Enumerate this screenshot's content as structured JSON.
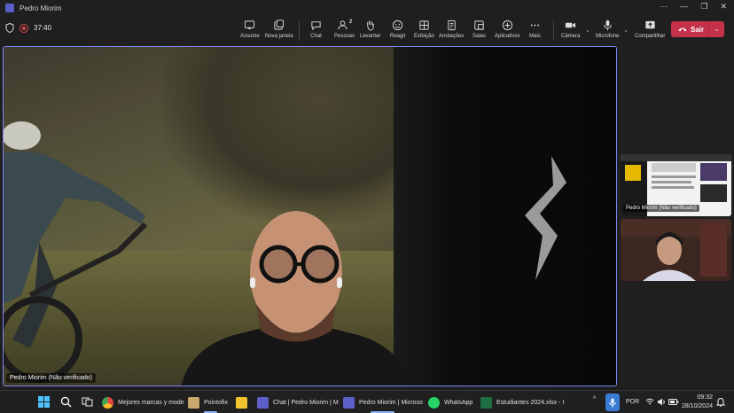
{
  "window": {
    "title": "Pedro Miorim",
    "controls": [
      "···",
      "—",
      "❐",
      "✕"
    ]
  },
  "meeting": {
    "timer": "37:40"
  },
  "toolbar": {
    "buttons": [
      {
        "label": "Assume",
        "icon": "share-control-icon"
      },
      {
        "label": "Nova janela",
        "icon": "new-window-icon"
      },
      {
        "label": "Chat",
        "icon": "chat-icon"
      },
      {
        "label": "Pessoas",
        "icon": "people-icon",
        "count": "2"
      },
      {
        "label": "Levantar",
        "icon": "raise-hand-icon"
      },
      {
        "label": "Reagir",
        "icon": "react-icon"
      },
      {
        "label": "Exibição",
        "icon": "view-icon"
      },
      {
        "label": "Anotações",
        "icon": "notes-icon"
      },
      {
        "label": "Salas",
        "icon": "rooms-icon"
      },
      {
        "label": "Aplicativos",
        "icon": "apps-icon"
      },
      {
        "label": "Mais",
        "icon": "more-icon"
      }
    ],
    "camera_label": "Câmera",
    "mic_label": "Microfone",
    "share_label": "Compartilhar",
    "leave_label": "Sair"
  },
  "main_video": {
    "participant": "Pedro Miorim (Não verificado)"
  },
  "side_tiles": [
    {
      "participant": "Pedro Miorim (Não verificado)"
    },
    {
      "participant": ""
    }
  ],
  "taskbar": {
    "items": [
      {
        "label": "Mejores marcas y mode",
        "icon": "chrome-icon",
        "color": "#e8453c"
      },
      {
        "label": "Pointofix",
        "icon": "pointofix-icon",
        "color": "#c9a66b"
      },
      {
        "label": "",
        "icon": "file-explorer-icon",
        "color": "#f4c430"
      },
      {
        "label": "Chat | Pedro Miorim | M",
        "icon": "teams-icon",
        "color": "#5b5fc7"
      },
      {
        "label": "Pedro Miorim | Microso",
        "icon": "teams-icon",
        "color": "#5b5fc7"
      },
      {
        "label": "WhatsApp",
        "icon": "whatsapp-icon",
        "color": "#25d366"
      },
      {
        "label": "Estudiantes 2024.xlsx - I",
        "icon": "excel-icon",
        "color": "#1d6f42"
      }
    ],
    "language": "POR",
    "time": "09:32",
    "date": "28/10/2024"
  },
  "colors": {
    "accent": "#7f85f5",
    "leave": "#c4314b",
    "teams": "#5b5fc7"
  }
}
